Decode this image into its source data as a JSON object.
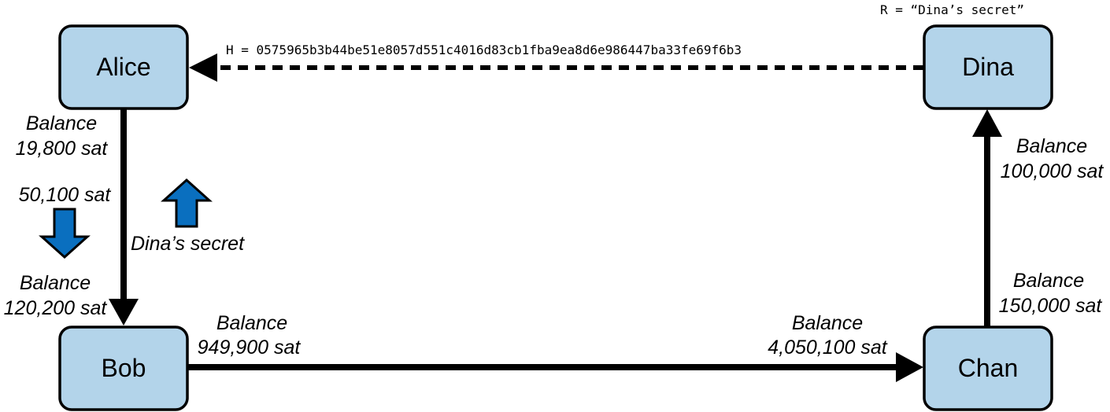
{
  "nodes": {
    "alice": "Alice",
    "bob": "Bob",
    "chan": "Chan",
    "dina": "Dina"
  },
  "hash_label": "H = 0575965b3b44be51e8057d551c4016d83cb1fba9ea8d6e986447ba33fe69f6b3",
  "secret_label": "R = “Dina’s secret”",
  "alice_bob": {
    "alice_balance_label": "Balance",
    "alice_balance": "19,800 sat",
    "payment": "50,100 sat",
    "bob_balance_label": "Balance",
    "bob_balance": "120,200 sat",
    "secret_flow": "Dina’s secret"
  },
  "bob_chan": {
    "bob_balance_label": "Balance",
    "bob_balance": "949,900 sat",
    "chan_balance_label": "Balance",
    "chan_balance": "4,050,100 sat"
  },
  "chan_dina": {
    "dina_balance_label": "Balance",
    "dina_balance": "100,000 sat",
    "chan_balance_label": "Balance",
    "chan_balance": "150,000 sat"
  },
  "colors": {
    "node_fill": "#b3d4ea",
    "flow_arrow": "#0a6fbf"
  }
}
